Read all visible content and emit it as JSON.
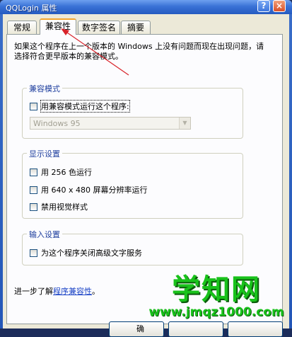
{
  "window": {
    "title": "QQLogin 属性",
    "help_label": "?",
    "close_label": "×"
  },
  "tabs": [
    {
      "label": "常规"
    },
    {
      "label": "兼容性"
    },
    {
      "label": "数字签名"
    },
    {
      "label": "摘要"
    }
  ],
  "active_tab": "兼容性",
  "description": "如果这个程序在上一个版本的 Windows 上没有问题而现在出现问题，请选择符合更早版本的兼容模式。",
  "compat_mode": {
    "group_label": "兼容模式",
    "checkbox_label": "用兼容模式运行这个程序:",
    "checked": false,
    "select_value": "Windows 95"
  },
  "display": {
    "group_label": "显示设置",
    "options": [
      {
        "label": "用 256 色运行",
        "checked": false
      },
      {
        "label": "用 640 x 480 屏幕分辨率运行",
        "checked": false
      },
      {
        "label": "禁用视觉样式",
        "checked": false
      }
    ]
  },
  "input": {
    "group_label": "输入设置",
    "options": [
      {
        "label": "为这个程序关闭高级文字服务",
        "checked": false
      }
    ]
  },
  "footer": {
    "prefix": "进一步了解",
    "link": "程序兼容性",
    "suffix": "。"
  },
  "buttons": {
    "ok_partial": "确"
  },
  "watermark": {
    "brand": "学知网",
    "url": "www.jmqz1000.com"
  },
  "colors": {
    "accent_arrow": "#d8232a",
    "group_label": "#1f3f9e",
    "watermark": "#19c21b"
  }
}
